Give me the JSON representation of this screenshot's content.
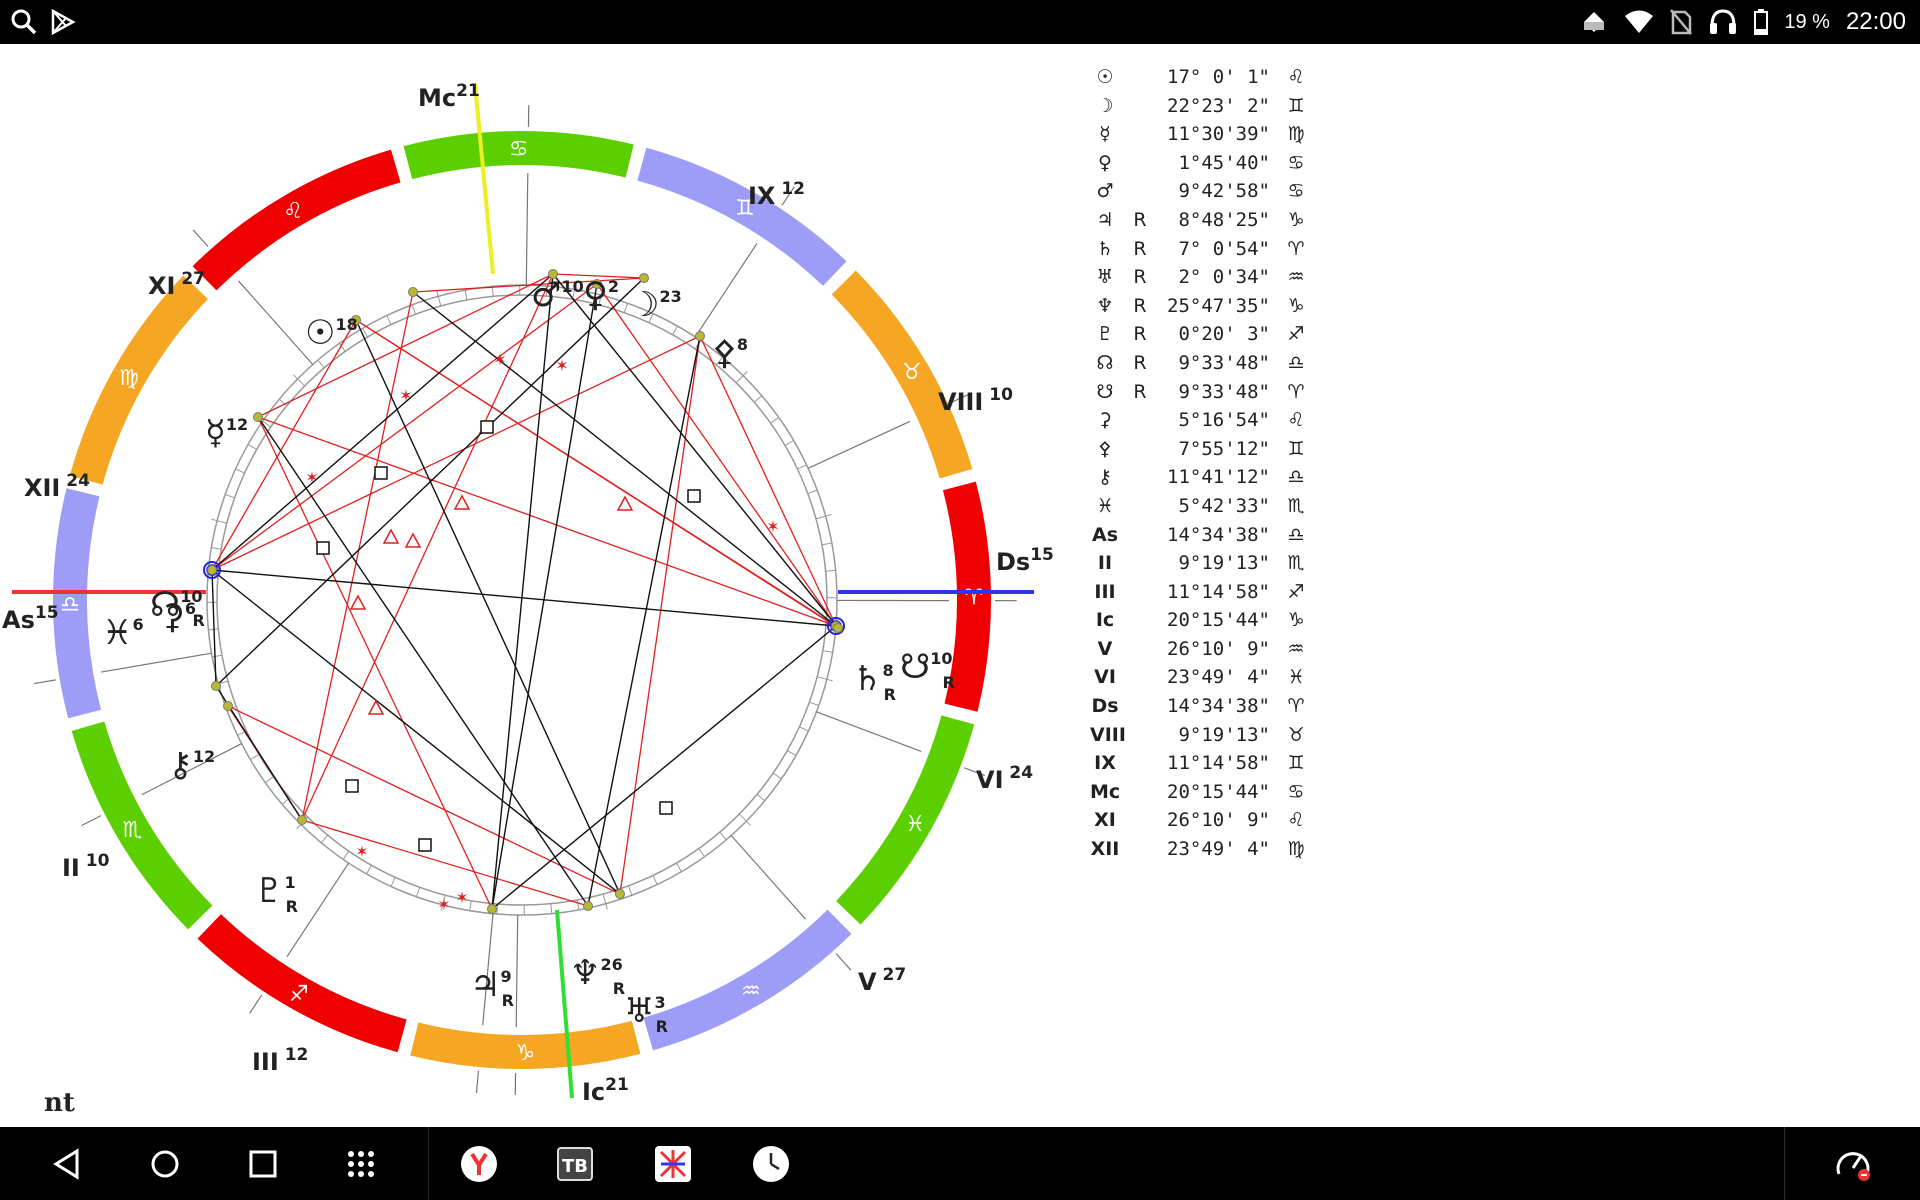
{
  "status_bar": {
    "icons_left": [
      "search-icon",
      "play-store-icon"
    ],
    "icons_right": [
      "notification-icon",
      "wifi-icon",
      "no-sim-icon",
      "headset-icon",
      "battery-icon"
    ],
    "battery": "19 %",
    "time": "22:00"
  },
  "chart": {
    "name": "nt",
    "signs": [
      {
        "glyph": "♈",
        "color": "#f00000"
      },
      {
        "glyph": "♉",
        "color": "#f5a623"
      },
      {
        "glyph": "♊",
        "color": "#9d9df7"
      },
      {
        "glyph": "♋",
        "color": "#5ccf00"
      },
      {
        "glyph": "♌",
        "color": "#f00000"
      },
      {
        "glyph": "♍",
        "color": "#f5a623"
      },
      {
        "glyph": "♎",
        "color": "#9d9df7"
      },
      {
        "glyph": "♏",
        "color": "#5ccf00"
      },
      {
        "glyph": "♐",
        "color": "#f00000"
      },
      {
        "glyph": "♑",
        "color": "#f5a623"
      },
      {
        "glyph": "♒",
        "color": "#9d9df7"
      },
      {
        "glyph": "♓",
        "color": "#5ccf00"
      }
    ],
    "angles": [
      {
        "label": "As",
        "deg": "15",
        "color": "#ee3333"
      },
      {
        "label": "Ds",
        "deg": "15",
        "color": "#3333ee"
      },
      {
        "label": "Mc",
        "deg": "21",
        "color": "#eeee22"
      },
      {
        "label": "Ic",
        "deg": "21",
        "color": "#33dd33"
      }
    ],
    "cusps": [
      {
        "label": "XI",
        "deg": "27"
      },
      {
        "label": "XII",
        "deg": "24"
      },
      {
        "label": "II",
        "deg": "10"
      },
      {
        "label": "III",
        "deg": "12"
      },
      {
        "label": "V",
        "deg": "27"
      },
      {
        "label": "VI",
        "deg": "24"
      },
      {
        "label": "VIII",
        "deg": "10"
      },
      {
        "label": "IX",
        "deg": "12"
      }
    ],
    "planets": [
      {
        "glyph": "☉",
        "deg": "18",
        "r": ""
      },
      {
        "glyph": "☽",
        "deg": "23",
        "r": ""
      },
      {
        "glyph": "☿",
        "deg": "12",
        "r": ""
      },
      {
        "glyph": "♀",
        "deg": "2",
        "r": ""
      },
      {
        "glyph": "♂",
        "deg": "10",
        "r": ""
      },
      {
        "glyph": "♃",
        "deg": "9",
        "r": "R"
      },
      {
        "glyph": "♄",
        "deg": "8",
        "r": "R"
      },
      {
        "glyph": "♅",
        "deg": "3",
        "r": "R"
      },
      {
        "glyph": "♆",
        "deg": "26",
        "r": "R"
      },
      {
        "glyph": "♇",
        "deg": "1",
        "r": "R"
      },
      {
        "glyph": "☊",
        "deg": "10",
        "r": "R"
      },
      {
        "glyph": "☋",
        "deg": "10",
        "r": "R"
      },
      {
        "glyph": "⚳",
        "deg": "6",
        "r": ""
      },
      {
        "glyph": "⚴",
        "deg": "8",
        "r": ""
      },
      {
        "glyph": "⚷",
        "deg": "12",
        "r": ""
      },
      {
        "glyph": "♓",
        "deg": "6",
        "r": ""
      }
    ]
  },
  "positions_table": [
    {
      "symbol": "☉",
      "retro": "",
      "degree": "17° 0' 1\"",
      "sign": "♌"
    },
    {
      "symbol": "☽",
      "retro": "",
      "degree": "22°23' 2\"",
      "sign": "♊"
    },
    {
      "symbol": "☿",
      "retro": "",
      "degree": "11°30'39\"",
      "sign": "♍"
    },
    {
      "symbol": "♀",
      "retro": "",
      "degree": "1°45'40\"",
      "sign": "♋"
    },
    {
      "symbol": "♂",
      "retro": "",
      "degree": "9°42'58\"",
      "sign": "♋"
    },
    {
      "symbol": "♃",
      "retro": "R",
      "degree": "8°48'25\"",
      "sign": "♑"
    },
    {
      "symbol": "♄",
      "retro": "R",
      "degree": "7° 0'54\"",
      "sign": "♈"
    },
    {
      "symbol": "♅",
      "retro": "R",
      "degree": "2° 0'34\"",
      "sign": "♒"
    },
    {
      "symbol": "♆",
      "retro": "R",
      "degree": "25°47'35\"",
      "sign": "♑"
    },
    {
      "symbol": "♇",
      "retro": "R",
      "degree": "0°20' 3\"",
      "sign": "♐"
    },
    {
      "symbol": "☊",
      "retro": "R",
      "degree": "9°33'48\"",
      "sign": "♎"
    },
    {
      "symbol": "☋",
      "retro": "R",
      "degree": "9°33'48\"",
      "sign": "♈"
    },
    {
      "symbol": "⚳",
      "retro": "",
      "degree": "5°16'54\"",
      "sign": "♌"
    },
    {
      "symbol": "⚴",
      "retro": "",
      "degree": "7°55'12\"",
      "sign": "♊"
    },
    {
      "symbol": "⚷",
      "retro": "",
      "degree": "11°41'12\"",
      "sign": "♎"
    },
    {
      "symbol": "♓",
      "retro": "",
      "degree": "5°42'33\"",
      "sign": "♏"
    },
    {
      "symbol": "As",
      "retro": "",
      "degree": "14°34'38\"",
      "sign": "♎"
    },
    {
      "symbol": "II",
      "retro": "",
      "degree": "9°19'13\"",
      "sign": "♏"
    },
    {
      "symbol": "III",
      "retro": "",
      "degree": "11°14'58\"",
      "sign": "♐"
    },
    {
      "symbol": "Ic",
      "retro": "",
      "degree": "20°15'44\"",
      "sign": "♑"
    },
    {
      "symbol": "V",
      "retro": "",
      "degree": "26°10' 9\"",
      "sign": "♒"
    },
    {
      "symbol": "VI",
      "retro": "",
      "degree": "23°49' 4\"",
      "sign": "♓"
    },
    {
      "symbol": "Ds",
      "retro": "",
      "degree": "14°34'38\"",
      "sign": "♈"
    },
    {
      "symbol": "VIII",
      "retro": "",
      "degree": "9°19'13\"",
      "sign": "♉"
    },
    {
      "symbol": "IX",
      "retro": "",
      "degree": "11°14'58\"",
      "sign": "♊"
    },
    {
      "symbol": "Mc",
      "retro": "",
      "degree": "20°15'44\"",
      "sign": "♋"
    },
    {
      "symbol": "XI",
      "retro": "",
      "degree": "26°10' 9\"",
      "sign": "♌"
    },
    {
      "symbol": "XII",
      "retro": "",
      "degree": "23°49' 4\"",
      "sign": "♍"
    }
  ],
  "nav_bar": {
    "buttons": [
      "back-icon",
      "home-icon",
      "recents-icon",
      "app-drawer-icon"
    ],
    "apps": [
      "yandex-app-icon",
      "tb-app-icon",
      "astro-app-icon",
      "clock-app-icon"
    ],
    "right": [
      "speedometer-icon"
    ]
  }
}
